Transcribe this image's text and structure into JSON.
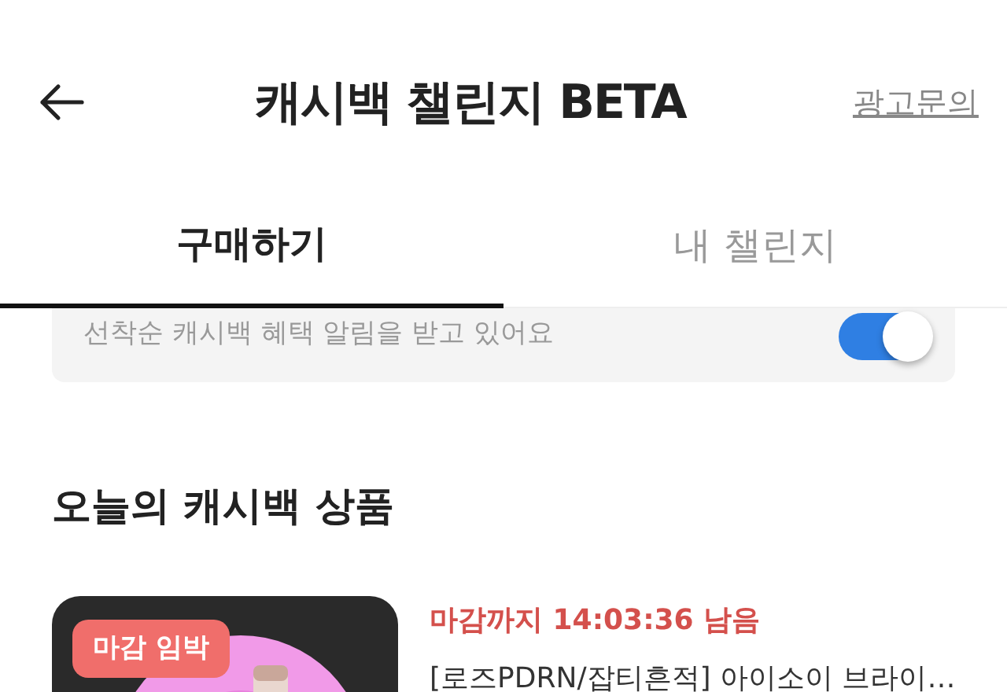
{
  "header": {
    "title": "캐시백 챌린지 BETA",
    "action": "광고문의"
  },
  "tabs": [
    {
      "label": "구매하기",
      "selected": true
    },
    {
      "label": "내 챌린지",
      "selected": false
    }
  ],
  "notification": {
    "text": "선착순 캐시백 혜택 알림을 받고 있어요",
    "on": true
  },
  "section_title": "오늘의 캐시백 상품",
  "products": [
    {
      "badge": "마감 임박",
      "countdown": "마감까지 14:03:36 남음",
      "name": "[로즈PDRN/잡티흔적] 아이소이 브라이…"
    }
  ]
}
